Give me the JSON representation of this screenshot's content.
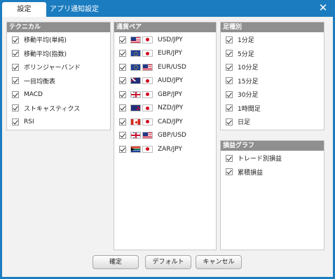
{
  "tabs": [
    {
      "label": "設定"
    },
    {
      "label": "アプリ通知設定"
    }
  ],
  "close_icon": "close-icon",
  "technical": {
    "title": "テクニカル",
    "items": [
      {
        "label": "移動平均(単純)",
        "checked": true
      },
      {
        "label": "移動平均(指数)",
        "checked": true
      },
      {
        "label": "ボリンジャーバンド",
        "checked": true
      },
      {
        "label": "一目均衡表",
        "checked": true
      },
      {
        "label": "MACD",
        "checked": true
      },
      {
        "label": "ストキャスティクス",
        "checked": true
      },
      {
        "label": "RSI",
        "checked": true
      }
    ]
  },
  "currency": {
    "title": "通貨ペア",
    "items": [
      {
        "label": "USD/JPY",
        "flags": [
          "us-flag-icon",
          "jp-flag-icon"
        ],
        "checked": true
      },
      {
        "label": "EUR/JPY",
        "flags": [
          "eu-flag-icon",
          "jp-flag-icon"
        ],
        "checked": true
      },
      {
        "label": "EUR/USD",
        "flags": [
          "eu-flag-icon",
          "us-flag-icon"
        ],
        "checked": true
      },
      {
        "label": "AUD/JPY",
        "flags": [
          "au-flag-icon",
          "jp-flag-icon"
        ],
        "checked": true
      },
      {
        "label": "GBP/JPY",
        "flags": [
          "gb-flag-icon",
          "jp-flag-icon"
        ],
        "checked": true
      },
      {
        "label": "NZD/JPY",
        "flags": [
          "nz-flag-icon",
          "jp-flag-icon"
        ],
        "checked": true
      },
      {
        "label": "CAD/JPY",
        "flags": [
          "ca-flag-icon",
          "jp-flag-icon"
        ],
        "checked": true
      },
      {
        "label": "GBP/USD",
        "flags": [
          "gb-flag-icon",
          "us-flag-icon"
        ],
        "checked": true
      },
      {
        "label": "ZAR/JPY",
        "flags": [
          "za-flag-icon",
          "jp-flag-icon"
        ],
        "checked": true
      }
    ]
  },
  "timeframe": {
    "title": "足種別",
    "items": [
      {
        "label": "1分足",
        "checked": true
      },
      {
        "label": "5分足",
        "checked": true
      },
      {
        "label": "10分足",
        "checked": true
      },
      {
        "label": "15分足",
        "checked": true
      },
      {
        "label": "30分足",
        "checked": true
      },
      {
        "label": "1時間足",
        "checked": true
      },
      {
        "label": "日足",
        "checked": true
      }
    ]
  },
  "profit_graph": {
    "title": "損益グラフ",
    "items": [
      {
        "label": "トレード別損益",
        "checked": true
      },
      {
        "label": "累積損益",
        "checked": true
      }
    ]
  },
  "buttons": {
    "confirm": "確定",
    "default": "デフォルト",
    "cancel": "キャンセル"
  },
  "colors": {
    "title_bar": "#1b7cc0",
    "panel_header": "#8f8f8f"
  }
}
